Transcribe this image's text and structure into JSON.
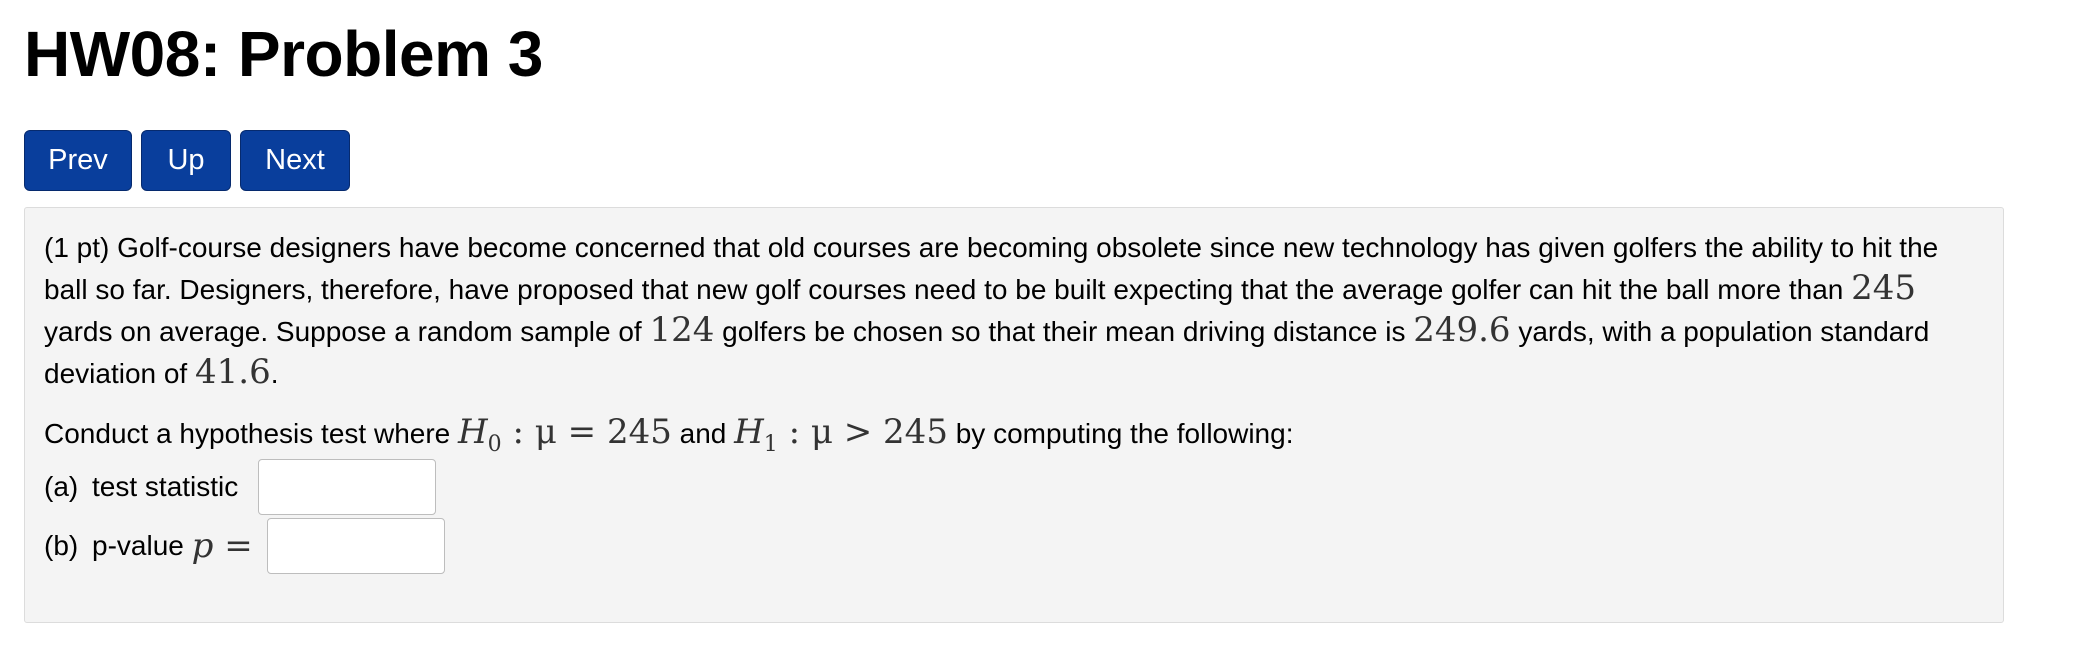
{
  "page": {
    "title": "HW08: Problem 3"
  },
  "nav": {
    "prev_label": "Prev",
    "up_label": "Up",
    "next_label": "Next"
  },
  "problem": {
    "points": "(1 pt)",
    "text_1": "Golf-course designers have become concerned that old courses are becoming obsolete since new technology has given golfers the ability to hit the ball so far. Designers, therefore, have proposed that new golf courses need to be built expecting that the average golfer can hit the ball more than",
    "value_mu0": "245",
    "text_2": "yards on average. Suppose a random sample of",
    "sample_size": "124",
    "text_3": "golfers be chosen so that their mean driving distance is",
    "sample_mean": "249.6",
    "text_4": "yards, with a population standard deviation of",
    "pop_sd": "41.6",
    "text_5": ".",
    "hyp_intro": "Conduct a hypothesis test where",
    "h0_symbol": "H",
    "h0_sub": "0",
    "h0_rel": " : μ = 245",
    "hyp_and": "and",
    "h1_symbol": "H",
    "h1_sub": "1",
    "h1_rel": " : μ > 245",
    "hyp_outro": "by computing the following:"
  },
  "parts": {
    "a": {
      "label": "(a)",
      "text": "test statistic",
      "value": ""
    },
    "b": {
      "label": "(b)",
      "text": "p-value",
      "math": "p =",
      "value": ""
    }
  }
}
